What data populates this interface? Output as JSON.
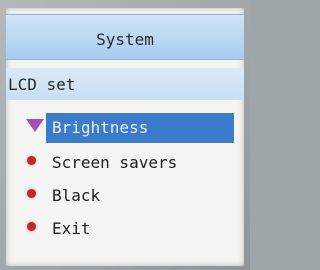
{
  "header": {
    "title": "System"
  },
  "section": {
    "title": "LCD set"
  },
  "menu": {
    "items": [
      {
        "label": "Brightness",
        "selected": true,
        "icon": "selection-arrow-icon"
      },
      {
        "label": "Screen savers",
        "selected": false,
        "icon": "bullet-icon"
      },
      {
        "label": "Black",
        "selected": false,
        "icon": "bullet-icon"
      },
      {
        "label": "Exit",
        "selected": false,
        "icon": "bullet-icon"
      }
    ]
  },
  "colors": {
    "title_bar": "#a7cdee",
    "highlight": "#3a7cc9",
    "bullet": "#c0282c",
    "selection_marker": "#a44fb2"
  }
}
